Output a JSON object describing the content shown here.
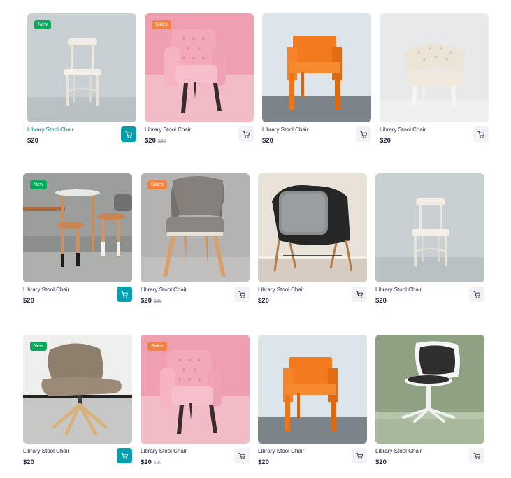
{
  "colors": {
    "accent": "#029fae",
    "new_badge": "#01ad5a",
    "sales_badge": "#f5813f",
    "text": "#272343",
    "muted": "#9a9caa"
  },
  "rows": [
    {
      "products": [
        {
          "name": "Library Stool Chair",
          "price": "$20",
          "old_price": "",
          "badge": "New",
          "badge_type": "new",
          "highlight": true,
          "image": "white-wooden-chair"
        },
        {
          "name": "Library Stool Chair",
          "price": "$20",
          "old_price": "$30",
          "badge": "Sales",
          "badge_type": "sales",
          "highlight": false,
          "image": "pink-armchair"
        },
        {
          "name": "Library Stool Chair",
          "price": "$20",
          "old_price": "",
          "badge": "",
          "badge_type": "",
          "highlight": false,
          "image": "orange-chair"
        },
        {
          "name": "Library Stool Chair",
          "price": "$20",
          "old_price": "",
          "badge": "",
          "badge_type": "",
          "highlight": false,
          "image": "white-tufted-chair"
        }
      ]
    },
    {
      "products": [
        {
          "name": "Library Stool Chair",
          "price": "$20",
          "old_price": "",
          "badge": "New",
          "badge_type": "new",
          "highlight": true,
          "image": "wooden-stools"
        },
        {
          "name": "Library Stool Chair",
          "price": "$20",
          "old_price": "$30",
          "badge": "Sales",
          "badge_type": "sales",
          "highlight": false,
          "image": "grey-fabric-chair"
        },
        {
          "name": "Library Stool Chair",
          "price": "$20",
          "old_price": "",
          "badge": "",
          "badge_type": "",
          "highlight": false,
          "image": "black-shell-chair"
        },
        {
          "name": "Library Stool Chair",
          "price": "$20",
          "old_price": "",
          "badge": "",
          "badge_type": "",
          "highlight": false,
          "image": "white-wooden-chair"
        }
      ]
    },
    {
      "products": [
        {
          "name": "Library Stool Chair",
          "price": "$20",
          "old_price": "",
          "badge": "New",
          "badge_type": "new",
          "highlight": true,
          "image": "lounge-chair"
        },
        {
          "name": "Library Stool Chair",
          "price": "$20",
          "old_price": "$30",
          "badge": "Sales",
          "badge_type": "sales",
          "highlight": false,
          "image": "pink-armchair"
        },
        {
          "name": "Library Stool Chair",
          "price": "$20",
          "old_price": "",
          "badge": "",
          "badge_type": "",
          "highlight": false,
          "image": "orange-chair"
        },
        {
          "name": "Library Stool Chair",
          "price": "$20",
          "old_price": "",
          "badge": "",
          "badge_type": "",
          "highlight": false,
          "image": "office-swivel-chair"
        }
      ]
    }
  ],
  "cart_icon": "cart-icon"
}
